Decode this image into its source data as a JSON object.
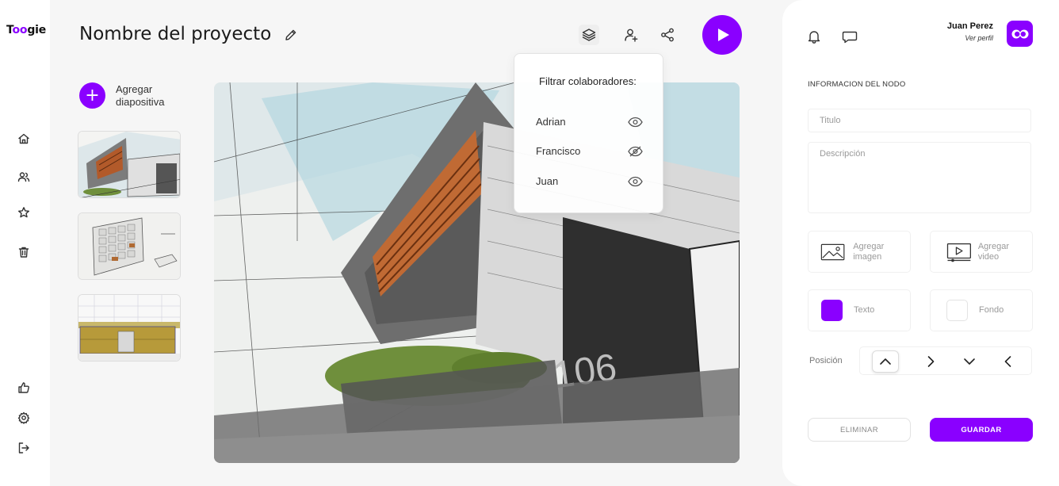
{
  "brand": {
    "logo_text": "Toogie",
    "accent": "#8a00ff"
  },
  "nav": {
    "top_items": [
      {
        "icon": "home-icon"
      },
      {
        "icon": "users-icon"
      },
      {
        "icon": "star-icon"
      },
      {
        "icon": "trash-icon"
      }
    ],
    "bottom_items": [
      {
        "icon": "thumbs-up-icon"
      },
      {
        "icon": "gear-icon"
      },
      {
        "icon": "logout-icon"
      }
    ]
  },
  "header": {
    "project_title": "Nombre del proyecto",
    "actions": [
      "layers-icon",
      "add-user-icon",
      "share-icon",
      "play-icon"
    ]
  },
  "slides": {
    "add_label": "Agregar diapositiva",
    "add_symbol": "+",
    "thumbnails": [
      "sketch-building",
      "sketch-cabinet",
      "sketch-kitchen"
    ]
  },
  "filter_popover": {
    "title": "Filtrar colaboradores:",
    "collaborators": [
      {
        "name": "Adrian",
        "visible": true
      },
      {
        "name": "Francisco",
        "visible": false
      },
      {
        "name": "Juan",
        "visible": true
      }
    ]
  },
  "panel": {
    "user": {
      "name": "Juan Perez",
      "link": "Ver perfil"
    },
    "section_title": "INFORMACION DEL NODO",
    "title_placeholder": "Titulo",
    "description_placeholder": "Descripción",
    "add_image": "Agregar imagen",
    "add_video": "Agregar video",
    "text_color": {
      "label": "Texto",
      "color": "#8a00ff"
    },
    "bg_color": {
      "label": "Fondo",
      "color": "#ffffff"
    },
    "position_label": "Posición",
    "position_selected": "up",
    "delete_label": "ELIMINAR",
    "save_label": "GUARDAR"
  }
}
